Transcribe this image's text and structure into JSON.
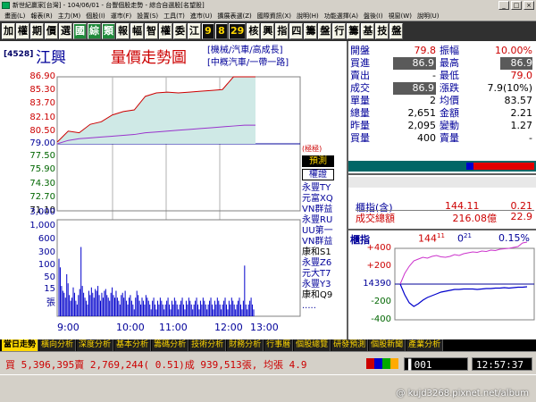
{
  "window": {
    "title": "新世紀贏家[台灣] - 104/06/01 - 台豐個股走勢 - 綜合自選股[名望股]"
  },
  "menu": [
    "畫面(L)",
    "報表(R)",
    "主力(M)",
    "個股(I)",
    "運市(F)",
    "設置(S)",
    "工具(T)",
    "進市(U)",
    "擴展表選(Z)",
    "國際資訊(X)",
    "說明(H)",
    "功能選擇(A)",
    "盤後(I)",
    "視窗(W)",
    "說明(U)"
  ],
  "toolbar": [
    "加",
    "權",
    "期",
    "價",
    "選",
    "國",
    "綜",
    "類",
    "報",
    "幅",
    "智",
    "權",
    "委",
    "江",
    "9",
    "8",
    "29",
    "核",
    "興",
    "指",
    "四",
    "籌",
    "盤",
    "行",
    "籌",
    "基",
    "技",
    "盤"
  ],
  "stock": {
    "code": "4528",
    "name": "江興",
    "chart_title": "量價走勢圖",
    "tags": [
      "機械/汽車/高成長",
      "中概汽車/一帶一路"
    ]
  },
  "price_axis": {
    "labels": [
      "86.90",
      "85.30",
      "83.70",
      "82.10",
      "80.50",
      "79.00",
      "77.50",
      "75.90",
      "74.30",
      "72.70",
      "71.10"
    ]
  },
  "volume_axis": {
    "labels": [
      "3,000",
      "1,000",
      "600",
      "300",
      "100",
      "50",
      "15",
      "張"
    ]
  },
  "time_axis": {
    "labels": [
      "9:00",
      "10:00",
      "11:00",
      "12:00",
      "13:00"
    ]
  },
  "side_buttons": {
    "tag": "(極極)",
    "predict": "預測",
    "warrant": "權證",
    "brokers": [
      "永豐TY",
      "元富XQ",
      "VN群益",
      "永豐RU",
      "UU第一",
      "VN群益",
      "康和S1",
      "永豐Z6",
      "元大T7",
      "永豐Y3",
      "康和Q9",
      "....."
    ]
  },
  "quote": {
    "rows": [
      {
        "l1": "開盤",
        "v1": "79.8",
        "l2": "振幅",
        "v2": "10.00%",
        "c1": "red",
        "c2": "red"
      },
      {
        "l1": "買進",
        "v1": "86.9",
        "l2": "最高",
        "v2": "86.9",
        "c1": "box",
        "c2": "box"
      },
      {
        "l1": "賣出",
        "v1": "-",
        "l2": "最低",
        "v2": "79.0",
        "c1": "blk",
        "c2": "red"
      },
      {
        "l1": "成交",
        "v1": "86.9",
        "l2": "漲跌",
        "v2": "7.9(10%)",
        "c1": "box",
        "c2": "blk"
      },
      {
        "l1": "單量",
        "v1": "2",
        "l2": "均價",
        "v2": "83.57",
        "c1": "blk",
        "c2": "blk"
      },
      {
        "l1": "總量",
        "v1": "2,651",
        "l2": "金額",
        "v2": "2.21",
        "c1": "blk",
        "c2": "blk"
      },
      {
        "l1": "昨量",
        "v1": "2,095",
        "l2": "變動",
        "v2": "1.27",
        "c1": "blk",
        "c2": "blk"
      },
      {
        "l1": "買量",
        "v1": "400",
        "l2": "賣量",
        "v2": "-",
        "c1": "blk",
        "c2": "blk"
      }
    ]
  },
  "index_info": {
    "label": "櫃指(含)",
    "value": "144.11",
    "change": "0.21",
    "total_label": "成交總額",
    "total_value": "216.08億",
    "total_pct": "22.9"
  },
  "mini_chart": {
    "title": "櫃指",
    "value": "144",
    "value_small": "11",
    "change": "0",
    "change_small": "21",
    "pct": "0.15%",
    "labels": [
      "+400",
      "+200",
      "14390",
      "-200",
      "-400"
    ]
  },
  "tabs": [
    "當日走勢",
    "橫向分析",
    "深度分析",
    "基本分析",
    "籌碼分析",
    "技術分析",
    "財務分析",
    "行事曆",
    "個股總覽",
    "研發預測",
    "個股新聞",
    "產業分析"
  ],
  "status": {
    "text": "買 5,396,395賣 2,769,244( 0.51)成 939,513張, 均張 4.9",
    "code": "001",
    "time": "12:57:37"
  },
  "watermark": "kujd3268.pixnet.net/album",
  "chart_data": [
    {
      "type": "line",
      "name": "price",
      "x": [
        "9:00",
        "9:15",
        "9:30",
        "9:45",
        "10:00",
        "10:15",
        "10:30",
        "10:45",
        "11:00",
        "11:15",
        "11:30",
        "11:45",
        "12:00",
        "12:15",
        "12:30",
        "12:45",
        "13:00",
        "13:15",
        "13:25"
      ],
      "values": [
        79.2,
        80.5,
        80.3,
        81.3,
        81.6,
        82.4,
        82.8,
        83.0,
        84.6,
        85.0,
        85.1,
        85.0,
        85.1,
        85.2,
        85.3,
        85.4,
        86.9,
        86.9,
        86.9
      ],
      "average": [
        79.0,
        79.4,
        79.6,
        79.7,
        79.8,
        79.9,
        80.0,
        80.1,
        80.3,
        80.4,
        80.5,
        80.6,
        80.7,
        80.8,
        80.9,
        81.0,
        81.1,
        81.2,
        81.2
      ],
      "reference": 79.0,
      "ylim": [
        71.1,
        86.9
      ],
      "yticks": [
        "86.90",
        "85.30",
        "83.70",
        "82.10",
        "80.50",
        "79.00",
        "77.50",
        "75.90",
        "74.30",
        "72.70",
        "71.10"
      ],
      "xticks": [
        "9:00",
        "10:00",
        "11:00",
        "12:00",
        "13:00"
      ]
    },
    {
      "type": "bar",
      "name": "volume",
      "values": [
        300,
        180,
        60,
        45,
        40,
        30,
        120,
        70,
        35,
        25,
        30,
        55,
        40,
        25,
        20,
        35,
        50,
        600,
        60,
        40,
        30,
        25,
        20,
        45,
        35,
        55,
        40,
        30,
        50,
        45,
        60,
        35,
        25,
        40,
        30,
        45,
        50,
        35,
        30,
        25,
        40,
        55,
        35,
        30,
        45,
        30,
        25,
        20,
        35,
        40,
        30,
        45,
        25,
        20,
        30,
        35,
        25,
        20,
        15,
        30,
        45,
        35,
        25,
        20,
        30,
        25,
        20,
        35,
        30,
        25,
        20,
        15,
        25,
        30,
        20,
        15,
        25,
        20,
        30,
        25,
        20,
        15,
        20,
        25,
        30,
        20,
        15,
        25,
        20,
        30,
        25,
        20,
        15,
        20,
        25,
        30,
        20,
        15,
        25,
        20,
        30,
        25,
        20,
        15,
        20,
        25,
        30,
        20,
        15,
        25,
        20,
        30,
        25,
        20,
        15,
        20,
        25,
        30,
        20,
        15,
        25,
        20,
        30,
        25,
        20,
        15,
        20,
        25,
        30,
        20,
        15,
        25,
        20,
        30,
        25,
        20,
        15,
        20,
        25,
        30,
        20,
        15,
        25,
        200,
        20,
        15,
        20,
        25,
        30,
        20,
        15
      ],
      "yticks": [
        "3,000",
        "1,000",
        "600",
        "300",
        "100",
        "50",
        "15"
      ]
    },
    {
      "type": "line",
      "name": "index_mini",
      "values": [
        0,
        -120,
        -210,
        -250,
        -220,
        -180,
        -150,
        -130,
        -110,
        -90,
        -80,
        -70,
        -60,
        -60,
        -55,
        -55,
        -55,
        -60,
        -55,
        -50,
        -50,
        -45,
        -45,
        -40,
        -45,
        -40,
        -35,
        -35,
        -30
      ],
      "values_up": [
        0,
        120,
        200,
        260,
        280,
        300,
        290,
        310,
        320,
        305,
        300,
        310,
        330,
        320,
        340,
        350,
        360,
        355,
        370,
        365,
        380,
        375,
        390,
        395,
        400,
        410,
        420,
        460,
        470
      ],
      "ylim": [
        -400,
        400
      ]
    }
  ]
}
